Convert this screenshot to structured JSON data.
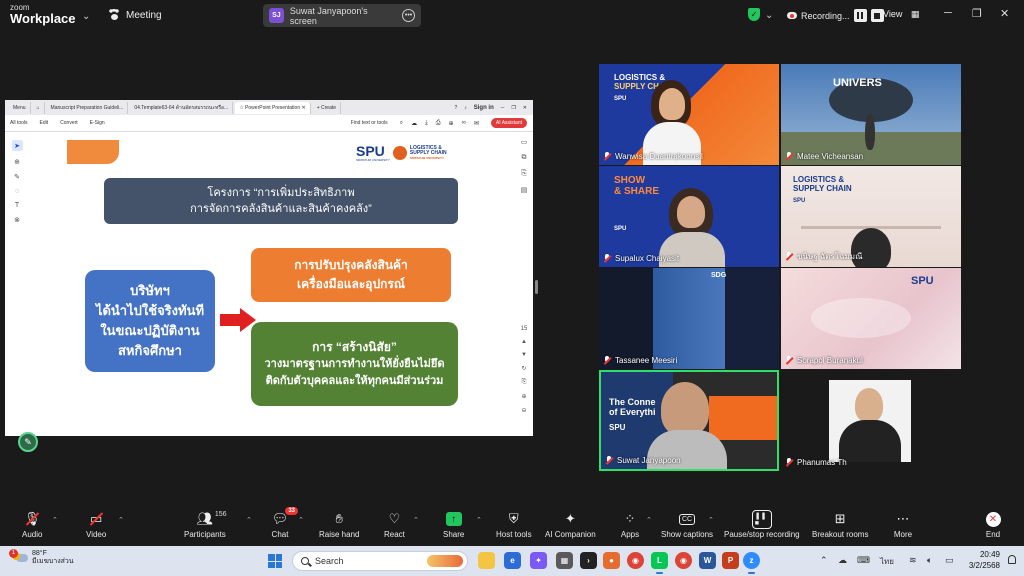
{
  "topbar": {
    "brand_small": "zoom",
    "brand_big": "Workplace",
    "meeting_label": "Meeting",
    "presenter_initials": "SJ",
    "presenter_screen": "Suwat Janyapoon's screen",
    "recording_label": "Recording...",
    "view_label": "View"
  },
  "browser": {
    "tabs": [
      "Menu",
      "Manuscript Preparation Guideli...",
      "04.Template63-64 ด้านอัตรสมรรถนะหรือ...",
      "PowerPoint Presentation",
      "Create"
    ],
    "signin": "Sign in",
    "toolbar": [
      "All tools",
      "Edit",
      "Convert",
      "E-Sign"
    ],
    "find_text": "Find text or tools",
    "ai_button": "AI Assistant",
    "page_number": "15"
  },
  "slide": {
    "logo_spu": "SPU",
    "logo_spu_sub": "SRIPATUM UNIVERSITY",
    "logo_lsc_line1": "LOGISTICS &",
    "logo_lsc_line2": "SUPPLY CHAIN",
    "logo_lsc_sub": "SRIPATUM UNIVERSITY",
    "title_line1": "โครงการ “การเพิ่มประสิทธิภาพ",
    "title_line2": "การจัดการคลังสินค้าและสินค้าคงคลัง”",
    "company_lines": [
      "บริษัทฯ",
      "ได้นำไปใช้จริงทันที",
      "ในขณะปฏิบัติงาน",
      "สหกิจศึกษา"
    ],
    "improve_lines": [
      "การปรับปรุงคลังสินค้า",
      "เครื่องมือและอุปกรณ์"
    ],
    "habit_lines": [
      "การ “สร้างนิสัย”",
      "วางมาตรฐานการทำงานให้ยั่งยืนไม่ยึด",
      "ติดกับตัวบุคคลและให้ทุกคนมีส่วนร่วม"
    ],
    "colors": {
      "title_box": "#44536a",
      "company_box": "#4472c4",
      "improve_box": "#ed7d31",
      "habit_box": "#548235",
      "arrow": "#e02020"
    }
  },
  "participants": [
    {
      "name": "Wanwisa Duantrakoonsil",
      "overlay_title1": "LOGISTICS &",
      "overlay_title2": "SUPPLY CHAIN",
      "overlay_logo": "SPU"
    },
    {
      "name": "Matee Vicheansan",
      "overlay_sign": "UNIVERS"
    },
    {
      "name": "Supalux Chaiyasit",
      "overlay_title1": "SHOW",
      "overlay_title2": "& SHARE",
      "overlay_logo": "SPU"
    },
    {
      "name": "ขนิษฐ  ฉัตรโฉมมณี",
      "overlay_title1": "LOGISTICS &",
      "overlay_title2": "SUPPLY CHAIN",
      "overlay_logo": "SPU"
    },
    {
      "name": "Tassanee Meesiri",
      "overlay_title1": "SDG"
    },
    {
      "name": "Sorapol Buranakul",
      "overlay_logo": "SPU"
    },
    {
      "name": "Suwat Janyapoon",
      "overlay_title1": "The Conne",
      "overlay_title2": "of Everythi",
      "overlay_logo": "SPU"
    },
    {
      "name": "Phanumas Th"
    }
  ],
  "controls": {
    "audio": "Audio",
    "video": "Video",
    "participants": "Participants",
    "participants_count": "156",
    "chat": "Chat",
    "chat_badge": "33",
    "raise_hand": "Raise hand",
    "react": "React",
    "share": "Share",
    "host_tools": "Host tools",
    "ai_companion": "AI Companion",
    "apps": "Apps",
    "show_captions": "Show captions",
    "captions_icon_text": "CC",
    "pause_recording": "Pause/stop recording",
    "breakout_rooms": "Breakout rooms",
    "more": "More",
    "end": "End"
  },
  "taskbar": {
    "weather_badge": "1",
    "temperature": "88°F",
    "weather_desc": "มีเมฆบางส่วน",
    "search_placeholder": "Search",
    "lang": "ไทย",
    "time": "20:49",
    "date": "3/2/2568"
  }
}
